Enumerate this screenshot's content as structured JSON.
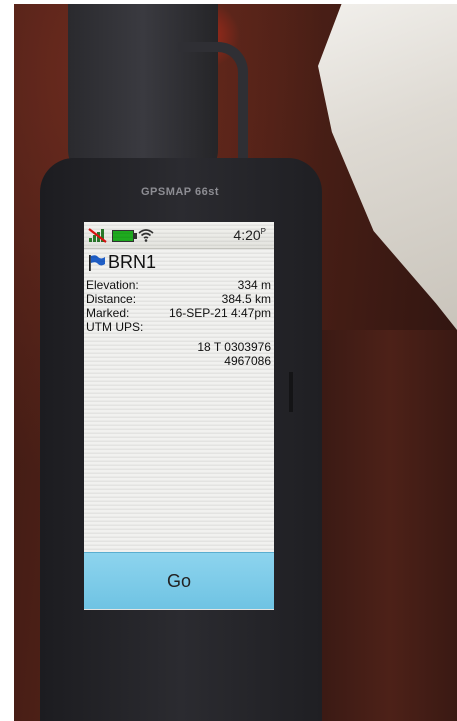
{
  "device": {
    "model": "GPSMAP 66st"
  },
  "status_bar": {
    "signal_icon": "no-signal-icon",
    "battery_icon": "battery-icon",
    "wifi_icon": "wifi-icon",
    "time": "4:20",
    "ampm": "P"
  },
  "waypoint": {
    "icon": "blue-flag-icon",
    "name": "BRN1",
    "rows": [
      {
        "label": "Elevation:",
        "value": "334 m"
      },
      {
        "label": "Distance:",
        "value": "384.5 km"
      },
      {
        "label": "Marked:",
        "value": "16-SEP-21 4:47pm"
      },
      {
        "label": "UTM UPS:",
        "value": ""
      }
    ],
    "utm_line1": "18  T 0303976",
    "utm_line2": "4967086"
  },
  "actions": {
    "go_label": "Go"
  },
  "colors": {
    "screen_bg": "#f1f1ef",
    "go_button": "#7dcbe8",
    "flag": "#1f5fc8",
    "battery": "#1faa1f"
  }
}
